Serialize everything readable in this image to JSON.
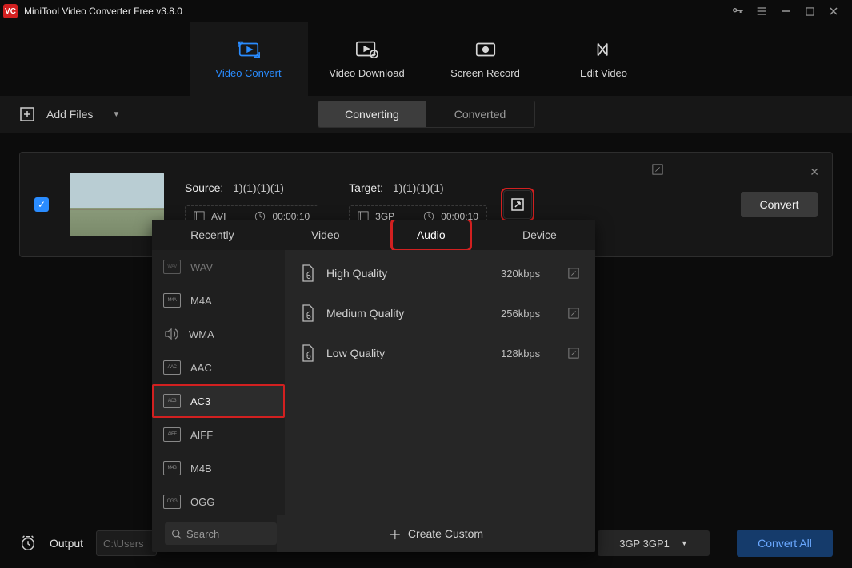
{
  "titlebar": {
    "app_name": "MiniTool Video Converter Free v3.8.0",
    "logo_text": "VC"
  },
  "main_tabs": {
    "video_convert": "Video Convert",
    "video_download": "Video Download",
    "screen_record": "Screen Record",
    "edit_video": "Edit Video"
  },
  "toolbar": {
    "add_files": "Add Files",
    "converting": "Converting",
    "converted": "Converted"
  },
  "file": {
    "source_label": "Source:",
    "source_name": "1)(1)(1)(1)",
    "source_fmt": "AVI",
    "source_dur": "00:00:10",
    "target_label": "Target:",
    "target_name": "1)(1)(1)(1)",
    "target_fmt": "3GP",
    "target_dur": "00:00:10",
    "convert": "Convert"
  },
  "picker": {
    "tabs": {
      "recently": "Recently",
      "video": "Video",
      "audio": "Audio",
      "device": "Device"
    },
    "formats": {
      "wav": "WAV",
      "m4a": "M4A",
      "wma": "WMA",
      "aac": "AAC",
      "ac3": "AC3",
      "aiff": "AIFF",
      "m4b": "M4B",
      "ogg": "OGG"
    },
    "badges": {
      "wav": "WAV",
      "m4a": "M4A",
      "wma": "",
      "aac": "AAC",
      "ac3": "AC3",
      "aiff": "AIFF",
      "m4b": "M4B",
      "ogg": "OGG"
    },
    "quality": [
      {
        "name": "High Quality",
        "bitrate": "320kbps"
      },
      {
        "name": "Medium Quality",
        "bitrate": "256kbps"
      },
      {
        "name": "Low Quality",
        "bitrate": "128kbps"
      }
    ],
    "search_placeholder": "Search",
    "create_custom": "Create Custom"
  },
  "bottom": {
    "output_label": "Output",
    "output_path": "C:\\Users",
    "preset": "3GP 3GP1",
    "convert_all": "Convert All"
  }
}
